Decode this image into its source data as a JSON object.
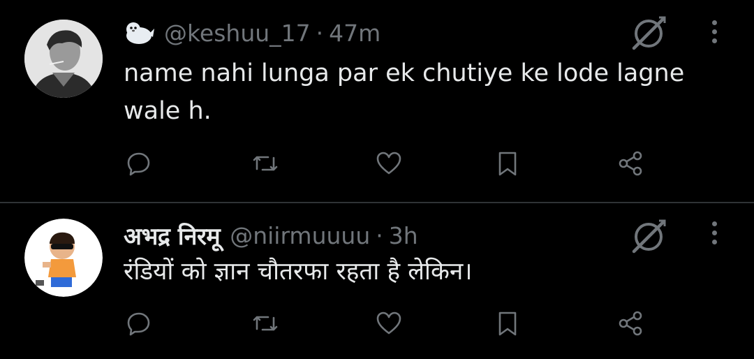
{
  "tweets": [
    {
      "handle": "@keshuu_17",
      "sep": "·",
      "time": "47m",
      "text": "name nahi lunga par ek chutiye ke lode lagne wale h.",
      "name_icon": "seal-emoji-icon"
    },
    {
      "display_name": "अभद्र निरमू",
      "handle": "@niirmuuuu",
      "sep": "·",
      "time": "3h",
      "text": "रंडियों को ज्ञान चौतरफा रहता है लेकिन।"
    }
  ],
  "icons": {
    "reply": "reply-icon",
    "repost": "repost-icon",
    "like": "heart-icon",
    "bookmark": "bookmark-icon",
    "share": "share-icon",
    "grok": "grok-icon",
    "more": "more-icon"
  },
  "colors": {
    "background": "#000000",
    "primary_text": "#e7e9ea",
    "secondary_text": "#71767b",
    "divider": "#2f3336"
  }
}
